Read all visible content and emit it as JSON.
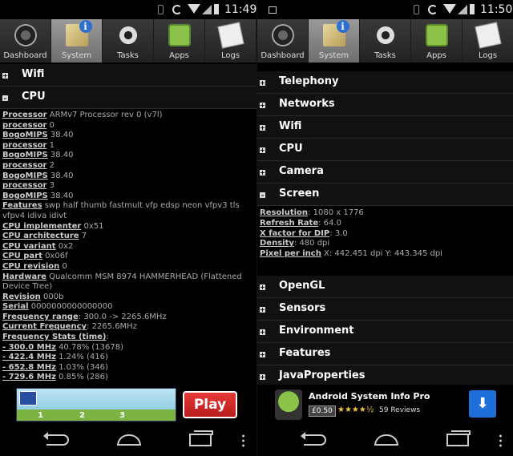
{
  "tab_labels": [
    "Dashboard",
    "System",
    "Tasks",
    "Apps",
    "Logs"
  ],
  "left": {
    "time": "11:49",
    "sections_top": [
      {
        "title": "Wifi",
        "toggle": "+"
      },
      {
        "title": "CPU",
        "toggle": "–"
      }
    ],
    "cpu_rows": [
      {
        "k": "Processor",
        "v": " ARMv7 Processor rev 0 (v7l)"
      },
      {
        "k": "processor",
        "v": " 0"
      },
      {
        "k": "BogoMIPS",
        "v": " 38.40"
      },
      {
        "k": "processor",
        "v": " 1"
      },
      {
        "k": "BogoMIPS",
        "v": " 38.40"
      },
      {
        "k": "processor",
        "v": " 2"
      },
      {
        "k": "BogoMIPS",
        "v": " 38.40"
      },
      {
        "k": "processor",
        "v": " 3"
      },
      {
        "k": "BogoMIPS",
        "v": " 38.40"
      },
      {
        "k": "Features",
        "v": " swp half thumb fastmult vfp edsp neon vfpv3 tls vfpv4 idiva idivt"
      },
      {
        "k": "CPU implementer",
        "v": " 0x51"
      },
      {
        "k": "CPU architecture",
        "v": " 7"
      },
      {
        "k": "CPU variant",
        "v": " 0x2"
      },
      {
        "k": "CPU part",
        "v": " 0x06f"
      },
      {
        "k": "CPU revision",
        "v": " 0"
      },
      {
        "k": "Hardware",
        "v": " Qualcomm MSM 8974 HAMMERHEAD (Flattened Device Tree)"
      },
      {
        "k": "Revision",
        "v": " 000b"
      },
      {
        "k": "Serial",
        "v": " 0000000000000000"
      },
      {
        "k": "Frequency range",
        "v": ": 300.0 -> 2265.6MHz"
      },
      {
        "k": "Current Frequency",
        "v": ": 2265.6MHz"
      },
      {
        "k": "Frequency Stats (time)",
        "v": ":"
      }
    ],
    "freq_rows": [
      {
        "k": "- 300.0 MHz",
        "v": " 40.78% (13678)"
      },
      {
        "k": "- 422.4 MHz",
        "v": " 1.24% (416)"
      },
      {
        "k": "- 652.8 MHz",
        "v": " 1.03% (346)"
      },
      {
        "k": "- 729.6 MHz",
        "v": " 0.85% (286)"
      }
    ],
    "ad": {
      "play_label": "Play",
      "levels": [
        "1",
        "2",
        "3"
      ]
    }
  },
  "right": {
    "time": "11:50",
    "sections_before": [
      {
        "title": "Telephony",
        "toggle": "+"
      },
      {
        "title": "Networks",
        "toggle": "+"
      },
      {
        "title": "Wifi",
        "toggle": "+"
      },
      {
        "title": "CPU",
        "toggle": "+"
      },
      {
        "title": "Camera",
        "toggle": "+"
      },
      {
        "title": "Screen",
        "toggle": "–"
      }
    ],
    "screen_rows": [
      {
        "k": "Resolution",
        "v": ": 1080 x 1776"
      },
      {
        "k": "Refresh Rate",
        "v": ": 64.0"
      },
      {
        "k": "X factor for DIP",
        "v": ": 3.0"
      },
      {
        "k": "Density",
        "v": ": 480 dpi"
      },
      {
        "k": "Pixel per inch",
        "v": " X: 442.451 dpi Y: 443.345 dpi"
      }
    ],
    "sections_after": [
      {
        "title": "OpenGL",
        "toggle": "+"
      },
      {
        "title": "Sensors",
        "toggle": "+"
      },
      {
        "title": "Environment",
        "toggle": "+"
      },
      {
        "title": "Features",
        "toggle": "+"
      },
      {
        "title": "JavaProperties",
        "toggle": "+"
      }
    ],
    "ad": {
      "app_name": "Android System Info Pro",
      "price": "£0.50",
      "stars": "★★★★½",
      "reviews": "59 Reviews",
      "download_symbol": "⬇"
    }
  },
  "colors": {
    "accent": "#1e6fd9",
    "play_button": "#e53935",
    "tab_active": "#8a8a8a"
  }
}
